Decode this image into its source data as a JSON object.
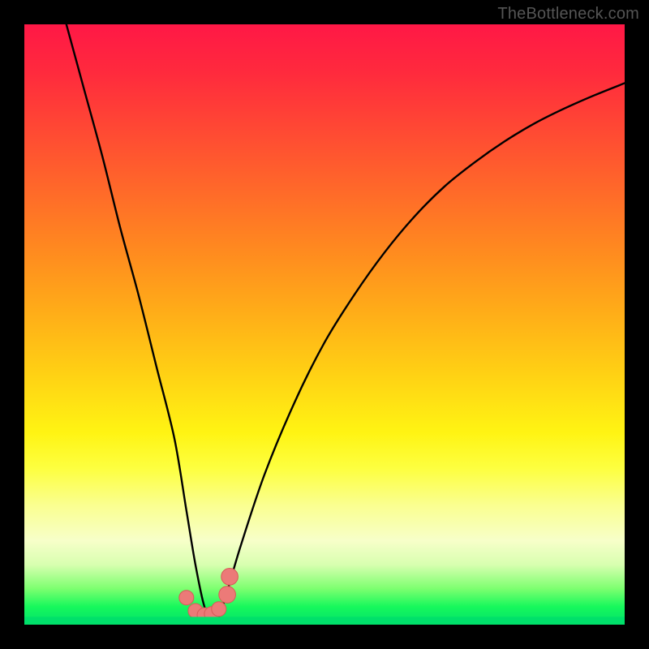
{
  "watermark": "TheBottleneck.com",
  "colors": {
    "frame_bg": "#000000",
    "curve": "#000000",
    "marker_fill": "#ec7a78",
    "marker_stroke": "#d85a57",
    "gradient_stops": [
      "#ff1846",
      "#ff2a3d",
      "#ff4a33",
      "#ff6a29",
      "#ff8b1f",
      "#ffad18",
      "#ffd014",
      "#fff413",
      "#fdff40",
      "#faff8f",
      "#f7ffc9",
      "#d8ffb0",
      "#7dff70",
      "#17f85c",
      "#00e26a"
    ]
  },
  "chart_data": {
    "type": "line",
    "title": "",
    "xlabel": "",
    "ylabel": "",
    "xlim": [
      0,
      100
    ],
    "ylim": [
      0,
      100
    ],
    "grid": false,
    "legend": false,
    "series": [
      {
        "name": "bottleneck-curve",
        "x": [
          7,
          10,
          13,
          16,
          19,
          22,
          25,
          27,
          28.5,
          30,
          31.5,
          33,
          36,
          40,
          45,
          50,
          55,
          60,
          65,
          70,
          75,
          80,
          85,
          90,
          95,
          100
        ],
        "values": [
          100,
          89,
          78,
          66,
          55,
          43,
          31,
          19,
          10,
          3,
          0.5,
          3,
          13,
          25,
          37,
          47,
          55,
          62,
          68,
          73,
          77,
          80.5,
          83.5,
          86,
          88.2,
          90.2
        ]
      }
    ],
    "markers": [
      {
        "x": 27.0,
        "y": 4.5,
        "r": 0.9
      },
      {
        "x": 28.5,
        "y": 2.3,
        "r": 0.9
      },
      {
        "x": 30.0,
        "y": 1.6,
        "r": 0.9
      },
      {
        "x": 31.2,
        "y": 1.8,
        "r": 0.9
      },
      {
        "x": 32.4,
        "y": 2.6,
        "r": 0.9
      },
      {
        "x": 33.8,
        "y": 5.0,
        "r": 1.1
      },
      {
        "x": 34.2,
        "y": 8.0,
        "r": 1.1
      }
    ],
    "bottom_band": {
      "start_y": 0.0,
      "end_y": 1.3
    }
  }
}
